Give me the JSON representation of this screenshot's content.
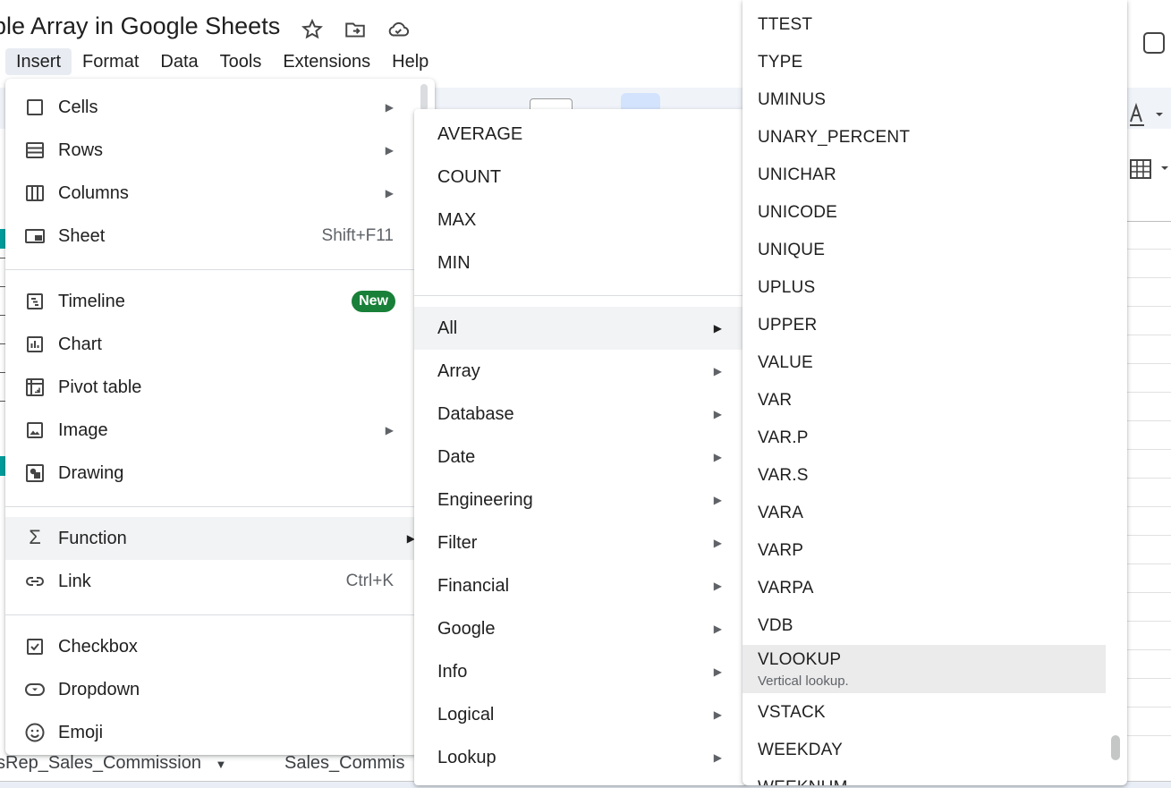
{
  "window": {
    "title": "ple Array in Google Sheets",
    "menubar": [
      "Insert",
      "Format",
      "Data",
      "Tools",
      "Extensions",
      "Help"
    ]
  },
  "sheet_tabs": [
    "sRep_Sales_Commission",
    "Sales_Commis"
  ],
  "insert_menu": {
    "items": [
      {
        "label": "Cells",
        "icon": "cells-icon",
        "submenu": true
      },
      {
        "label": "Rows",
        "icon": "rows-icon",
        "submenu": true
      },
      {
        "label": "Columns",
        "icon": "columns-icon",
        "submenu": true
      },
      {
        "label": "Sheet",
        "icon": "sheet-icon",
        "shortcut": "Shift+F11"
      },
      {
        "label": "Timeline",
        "icon": "timeline-icon",
        "badge": "New"
      },
      {
        "label": "Chart",
        "icon": "chart-icon"
      },
      {
        "label": "Pivot table",
        "icon": "pivot-table-icon"
      },
      {
        "label": "Image",
        "icon": "image-icon",
        "submenu": true
      },
      {
        "label": "Drawing",
        "icon": "drawing-icon"
      },
      {
        "label": "Function",
        "icon": "sigma-icon",
        "submenu": true,
        "highlighted": true
      },
      {
        "label": "Link",
        "icon": "link-icon",
        "shortcut": "Ctrl+K"
      },
      {
        "label": "Checkbox",
        "icon": "checkbox-icon"
      },
      {
        "label": "Dropdown",
        "icon": "dropdown-icon"
      },
      {
        "label": "Emoji",
        "icon": "emoji-icon"
      }
    ]
  },
  "function_menu": {
    "quick": [
      "AVERAGE",
      "COUNT",
      "MAX",
      "MIN"
    ],
    "categories": [
      "All",
      "Array",
      "Database",
      "Date",
      "Engineering",
      "Filter",
      "Financial",
      "Google",
      "Info",
      "Logical",
      "Lookup"
    ],
    "highlighted": "All"
  },
  "all_functions_menu": {
    "items": [
      "TTEST",
      "TYPE",
      "UMINUS",
      "UNARY_PERCENT",
      "UNICHAR",
      "UNICODE",
      "UNIQUE",
      "UPLUS",
      "UPPER",
      "VALUE",
      "VAR",
      "VAR.P",
      "VAR.S",
      "VARA",
      "VARP",
      "VARPA",
      "VDB",
      "VLOOKUP",
      "VSTACK",
      "WEEKDAY",
      "WEEKNUM"
    ],
    "highlighted": "VLOOKUP",
    "highlighted_desc": "Vertical lookup."
  },
  "colors": {
    "accent_green": "#188038",
    "highlight": "#f1f3f4",
    "toolbar": "#f0f4f9"
  }
}
